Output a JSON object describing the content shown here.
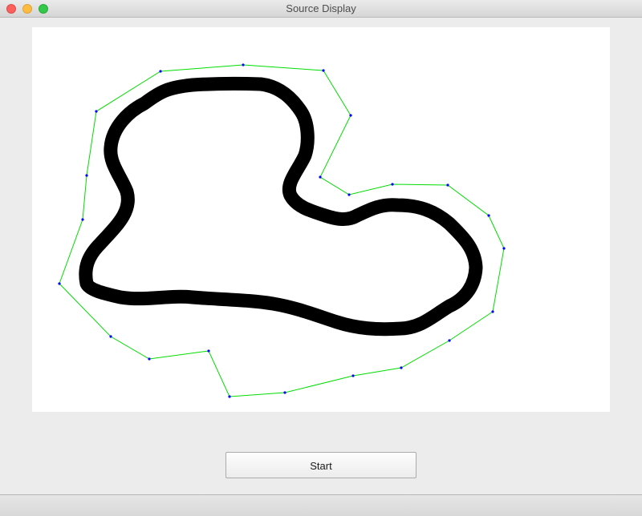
{
  "window": {
    "title": "Source Display"
  },
  "canvas": {
    "background": "#ffffff",
    "track_color": "#000000",
    "polygon_color": "#00dd00",
    "vertex_color": "#0000ff"
  },
  "controls": {
    "start_label": "Start"
  }
}
